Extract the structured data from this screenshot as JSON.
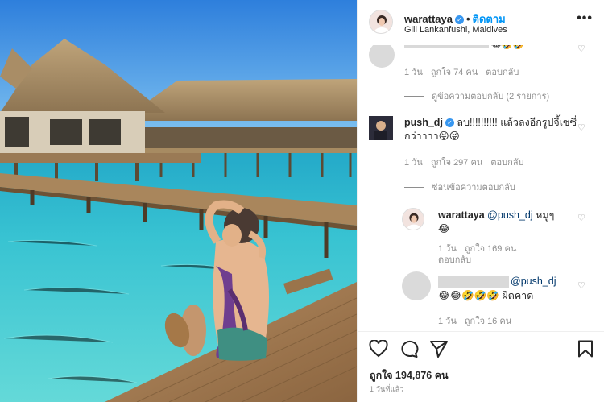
{
  "post": {
    "username": "warattaya",
    "follow_label": "ติดตาม",
    "location": "Gili Lankanfushi, Maldives",
    "more_icon": "more-horizontal-icon"
  },
  "comments": {
    "c1": {
      "emojis": "😂🤣🤣",
      "time": "1 วัน",
      "likes": "ถูกใจ 74 คน",
      "reply": "ตอบกลับ"
    },
    "c1_replies_toggle": "ดูข้อความตอบกลับ (2 รายการ)",
    "c2": {
      "username": "push_dj",
      "text": "ลบ!!!!!!!!!! แล้วลงอีกรูปจี้เซซี่กว่าาาา😝😝",
      "time": "1 วัน",
      "likes": "ถูกใจ 297 คน",
      "reply": "ตอบกลับ"
    },
    "c2_hide_toggle": "ซ่อนข้อความตอบกลับ",
    "r1": {
      "username": "warattaya",
      "mention": "@push_dj",
      "text": " หมูๆ",
      "emoji": "😂",
      "time": "1 วัน",
      "likes": "ถูกใจ 169 คน",
      "reply": "ตอบกลับ"
    },
    "r2": {
      "mention": "@push_dj",
      "emojis": "😂😂🤣🤣🤣",
      "text": " ผิดคาด",
      "time": "1 วัน",
      "likes": "ถูกใจ 16 คน"
    }
  },
  "actions": {
    "like_icon": "heart-icon",
    "comment_icon": "comment-icon",
    "share_icon": "share-icon",
    "save_icon": "bookmark-icon",
    "likes_label": "ถูกใจ 194,876 คน",
    "posted_time": "1 วันที่แล้ว"
  },
  "colors": {
    "link": "#0095f6",
    "verified": "#3897f0",
    "muted": "#8e8e8e",
    "sea": "#3fc6d2",
    "sky": "#3f8fe0"
  }
}
